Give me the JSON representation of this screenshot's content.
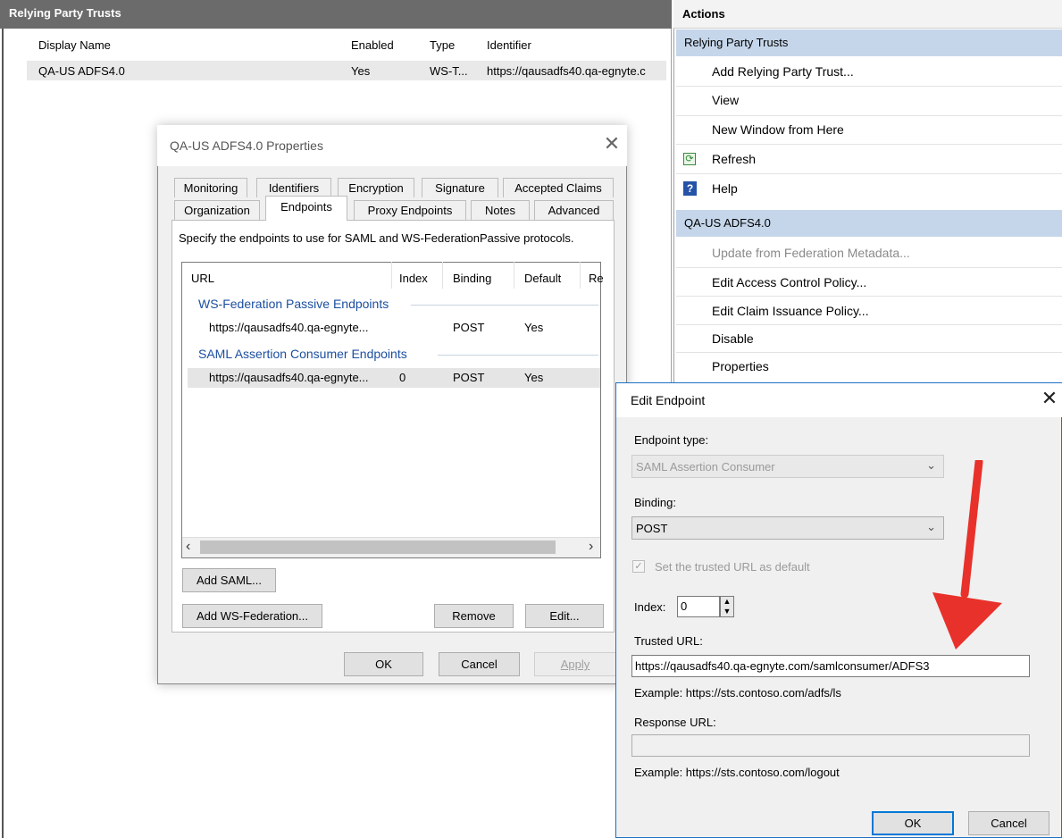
{
  "list_pane": {
    "header": "Relying Party Trusts",
    "columns": [
      "Display Name",
      "Enabled",
      "Type",
      "Identifier"
    ],
    "rows": [
      {
        "display_name": "QA-US ADFS4.0",
        "enabled": "Yes",
        "type": "WS-T...",
        "identifier": "https://qausadfs40.qa-egnyte.c"
      }
    ]
  },
  "actions": {
    "title": "Actions",
    "section1": {
      "title": "Relying Party Trusts",
      "items": [
        "Add Relying Party Trust...",
        "View",
        "New Window from Here",
        "Refresh",
        "Help"
      ]
    },
    "section2": {
      "title": "QA-US ADFS4.0",
      "items": [
        "Update from Federation Metadata...",
        "Edit Access Control Policy...",
        "Edit Claim Issuance Policy...",
        "Disable",
        "Properties"
      ]
    }
  },
  "properties_dialog": {
    "title": "QA-US ADFS4.0 Properties",
    "tabs_row1": [
      "Monitoring",
      "Identifiers",
      "Encryption",
      "Signature",
      "Accepted Claims"
    ],
    "tabs_row2": [
      "Organization",
      "Endpoints",
      "Proxy Endpoints",
      "Notes",
      "Advanced"
    ],
    "active_tab": "Endpoints",
    "description": "Specify the endpoints to use for SAML and WS-FederationPassive protocols.",
    "list_columns": [
      "URL",
      "Index",
      "Binding",
      "Default",
      "Re"
    ],
    "groups": [
      {
        "name": "WS-Federation Passive Endpoints",
        "rows": [
          {
            "url": "https://qausadfs40.qa-egnyte...",
            "index": "",
            "binding": "POST",
            "default": "Yes"
          }
        ]
      },
      {
        "name": "SAML Assertion Consumer Endpoints",
        "rows": [
          {
            "url": "https://qausadfs40.qa-egnyte...",
            "index": "0",
            "binding": "POST",
            "default": "Yes"
          }
        ]
      }
    ],
    "buttons": {
      "add_saml": "Add SAML...",
      "add_ws": "Add WS-Federation...",
      "remove": "Remove",
      "edit": "Edit...",
      "ok": "OK",
      "cancel": "Cancel",
      "apply": "Apply"
    }
  },
  "edit_dialog": {
    "title": "Edit Endpoint",
    "endpoint_type_label": "Endpoint type:",
    "endpoint_type_value": "SAML Assertion Consumer",
    "binding_label": "Binding:",
    "binding_value": "POST",
    "checkbox_label": "Set the trusted URL as default",
    "checkbox_checked": true,
    "index_label": "Index:",
    "index_value": "0",
    "trusted_url_label": "Trusted URL:",
    "trusted_url_value": "https://qausadfs40.qa-egnyte.com/samlconsumer/ADFS3",
    "trusted_example": "Example: https://sts.contoso.com/adfs/ls",
    "response_url_label": "Response URL:",
    "response_url_value": "",
    "response_example": "Example: https://sts.contoso.com/logout",
    "ok": "OK",
    "cancel": "Cancel"
  },
  "colors": {
    "annotation_arrow": "#e8312a",
    "group_header": "#1c4fa0",
    "selected_section": "#c5d6ea"
  }
}
